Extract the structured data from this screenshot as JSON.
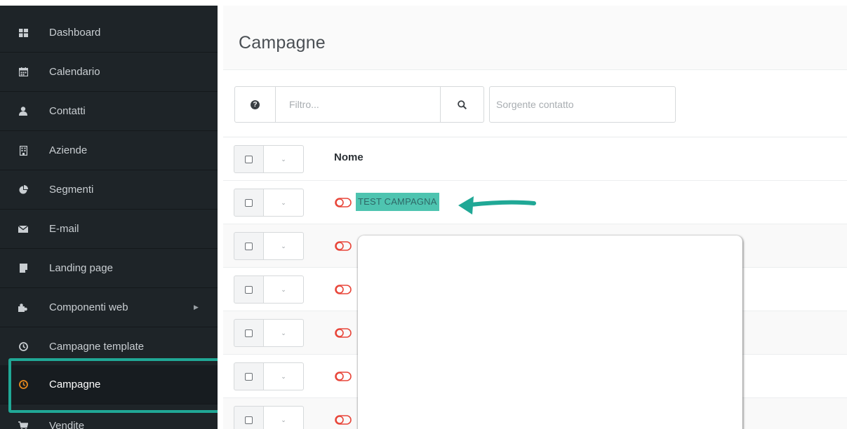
{
  "sidebar": {
    "items": [
      {
        "label": "Dashboard",
        "icon": "dashboard-icon"
      },
      {
        "label": "Calendario",
        "icon": "calendar-icon"
      },
      {
        "label": "Contatti",
        "icon": "user-icon"
      },
      {
        "label": "Aziende",
        "icon": "building-icon"
      },
      {
        "label": "Segmenti",
        "icon": "pie-chart-icon"
      },
      {
        "label": "E-mail",
        "icon": "envelope-icon"
      },
      {
        "label": "Landing page",
        "icon": "file-icon"
      },
      {
        "label": "Componenti web",
        "icon": "puzzle-icon"
      },
      {
        "label": "Campagne template",
        "icon": "clock-icon"
      },
      {
        "label": "Campagne",
        "icon": "clock-icon",
        "active": true
      },
      {
        "label": "Vendite",
        "icon": "cart-icon"
      }
    ],
    "active_color": "#e8891c",
    "highlight_color": "#20a896"
  },
  "header": {
    "title": "Campagne"
  },
  "filters": {
    "filter_placeholder": "Filtro...",
    "source_placeholder": "Sorgente contatto"
  },
  "table": {
    "column_name": "Nome",
    "rows": [
      {
        "name": "TEST CAMPAGNA",
        "highlighted": true
      },
      {
        "name": ""
      },
      {
        "name": ""
      },
      {
        "name": ""
      },
      {
        "name": ""
      },
      {
        "name": ""
      }
    ]
  },
  "colors": {
    "sidebar_bg": "#1e2428",
    "toggle_icon": "#e8463a",
    "annotation": "#20a896"
  }
}
